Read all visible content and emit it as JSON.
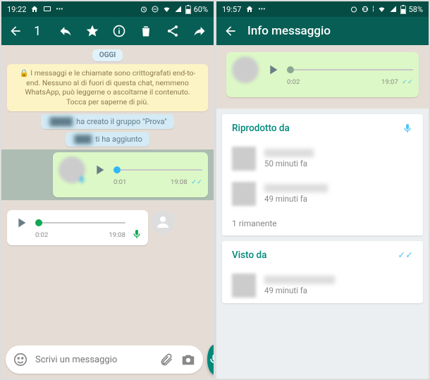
{
  "left": {
    "status": {
      "time": "19:22",
      "battery": "60%"
    },
    "toolbar": {
      "count": "1"
    },
    "date_chip": "OGGI",
    "encryption": "🔒 I messaggi e le chiamate sono crittografati end-to-end. Nessuno al di fuori di questa chat, nemmeno WhatsApp, può leggerne o ascoltarne il contenuto. Tocca per saperne di più.",
    "sys1_suffix": " ha creato il gruppo \"Prova\"",
    "sys2_suffix": " ti ha aggiunto",
    "voice_out": {
      "pos": "0:01",
      "time": "19:08"
    },
    "voice_in": {
      "pos": "0:02",
      "time": "19:08"
    },
    "input": {
      "placeholder": "Scrivi un messaggio"
    }
  },
  "right": {
    "status": {
      "time": "19:57",
      "battery": "58%"
    },
    "toolbar": {
      "title": "Info messaggio"
    },
    "preview": {
      "pos": "0:02",
      "time": "19:07"
    },
    "played": {
      "heading": "Riprodotto da",
      "rows": [
        {
          "time": "50 minuti fa"
        },
        {
          "time": "49 minuti fa"
        }
      ],
      "remaining": "1 rimanente"
    },
    "seen": {
      "heading": "Visto da",
      "rows": [
        {
          "time": "49 minuti fa"
        }
      ]
    }
  }
}
